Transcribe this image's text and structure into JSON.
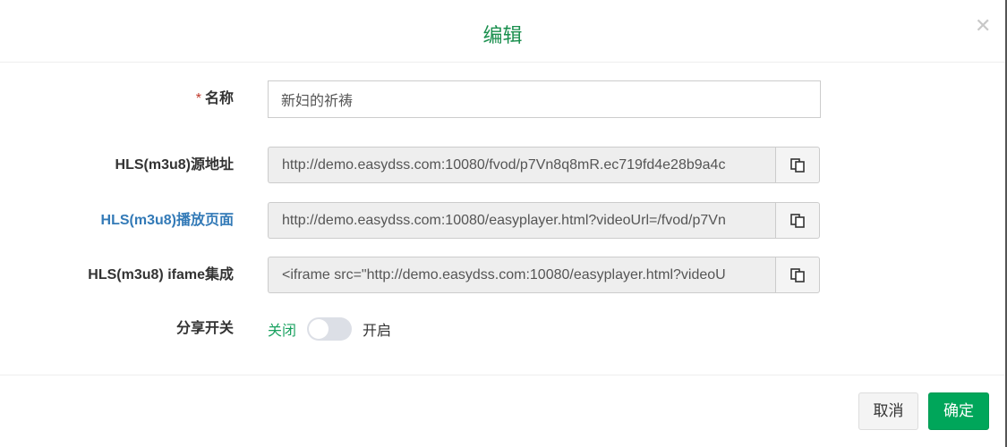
{
  "dialog": {
    "title": "编辑",
    "close_icon": "close-icon"
  },
  "form": {
    "name": {
      "required_mark": "*",
      "label": "名称",
      "value": "新妇的祈祷"
    },
    "hls_source": {
      "label": "HLS(m3u8)源地址",
      "value": "http://demo.easydss.com:10080/fvod/p7Vn8q8mR.ec719fd4e28b9a4c"
    },
    "hls_page": {
      "label": "HLS(m3u8)播放页面",
      "value": "http://demo.easydss.com:10080/easyplayer.html?videoUrl=/fvod/p7Vn"
    },
    "hls_iframe": {
      "label": "HLS(m3u8) ifame集成",
      "value": "<iframe src=\"http://demo.easydss.com:10080/easyplayer.html?videoU"
    },
    "share": {
      "label": "分享开关",
      "off_label": "关闭",
      "on_label": "开启",
      "enabled": false
    }
  },
  "footer": {
    "cancel_label": "取消",
    "confirm_label": "确定"
  },
  "colors": {
    "accent": "#00a65a",
    "link": "#337ab7"
  }
}
